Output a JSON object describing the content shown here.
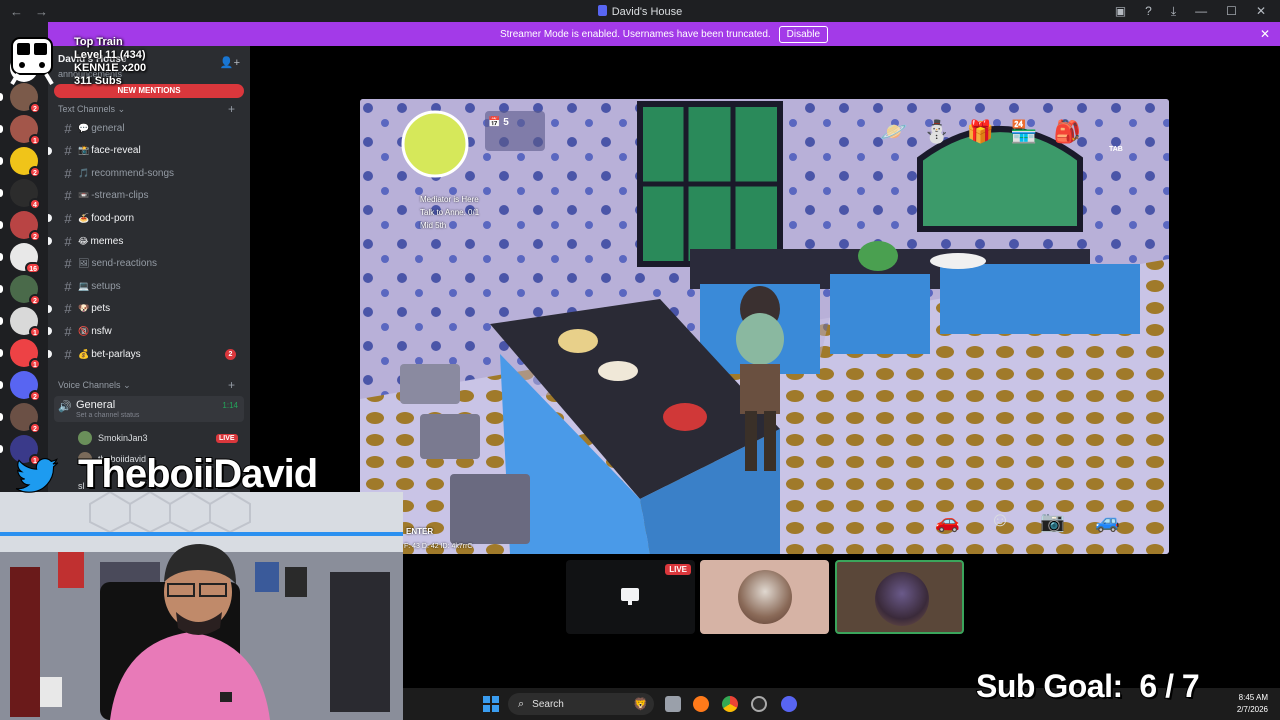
{
  "window": {
    "title": "David's House",
    "back_icon": "←",
    "forward_icon": "→",
    "controls": {
      "minimize": "—",
      "maximize": "☐",
      "close": "✕"
    }
  },
  "banner": {
    "text": "Streamer Mode is enabled. Usernames have been truncated.",
    "disable_label": "Disable",
    "close": "✕"
  },
  "overlay": {
    "top_train_label": "Top Train",
    "level_line": "Level 11 (434)",
    "gifter_line": "KENN1E x200",
    "subs_line": "311 Subs",
    "streamer_name": "TheboiiDavid",
    "sub_goal": "Sub Goal:  6 / 7"
  },
  "servers": [
    {
      "color": "#7b5a4a",
      "badge": "2"
    },
    {
      "color": "#a3564a",
      "badge": "1"
    },
    {
      "color": "#f0c419",
      "badge": "2"
    },
    {
      "color": "#2c2c2c",
      "badge": "4"
    },
    {
      "color": "#b94444",
      "badge": "2"
    },
    {
      "color": "#e8e8e8",
      "badge": "16"
    },
    {
      "color": "#4a6a4a",
      "badge": "2"
    },
    {
      "color": "#d9d9d9",
      "badge": "1"
    },
    {
      "color": "#ed4245",
      "badge": "1"
    },
    {
      "color": "#5865f2",
      "badge": "2"
    },
    {
      "color": "#6b5045",
      "badge": "2"
    },
    {
      "color": "#3a3a8a",
      "badge": "1"
    }
  ],
  "sidebar": {
    "server_name": "David's House",
    "announcements": "announcements",
    "new_mentions": "NEW MENTIONS",
    "text_category": "Text Channels",
    "voice_category": "Voice Channels",
    "channels": [
      {
        "emoji": "💬",
        "name": "general",
        "unread": false,
        "count": ""
      },
      {
        "emoji": "📸",
        "name": "face-reveal",
        "unread": true,
        "count": ""
      },
      {
        "emoji": "🎵",
        "name": "recommend-songs",
        "unread": false,
        "count": ""
      },
      {
        "emoji": "📼",
        "name": "-stream-clips",
        "unread": false,
        "count": ""
      },
      {
        "emoji": "🍝",
        "name": "food-porn",
        "unread": true,
        "count": ""
      },
      {
        "emoji": "😂",
        "name": "memes",
        "unread": true,
        "count": ""
      },
      {
        "emoji": "🖼",
        "name": "send-reactions",
        "unread": false,
        "count": ""
      },
      {
        "emoji": "💻",
        "name": "setups",
        "unread": false,
        "count": ""
      },
      {
        "emoji": "🐶",
        "name": "pets",
        "unread": true,
        "count": ""
      },
      {
        "emoji": "🔞",
        "name": "nsfw",
        "unread": true,
        "count": ""
      },
      {
        "emoji": "💰",
        "name": "bet-parlays",
        "unread": true,
        "count": "2"
      }
    ],
    "voice": {
      "name": "General",
      "time": "1:14",
      "status": "Set a channel status",
      "users": [
        {
          "name": "SmokinJan3",
          "live": "LIVE"
        },
        {
          "name": "theboiidavid",
          "live": ""
        },
        {
          "name": "sl",
          "live": ""
        }
      ]
    }
  },
  "game": {
    "quest_title": "Mediator is Here",
    "quest_task": "Talk to Anne. 0/1",
    "quest_time": "Mid 5th",
    "calendar_count": "5",
    "enter_label": "ENTER",
    "tab_label": "TAB",
    "coords": "F: 43  D: 42  ID: 4k7rrC"
  },
  "call": {
    "live_label": "LIVE"
  },
  "taskbar": {
    "search_placeholder": "Search",
    "time": "8:45 AM",
    "date": "2/7/2026"
  }
}
